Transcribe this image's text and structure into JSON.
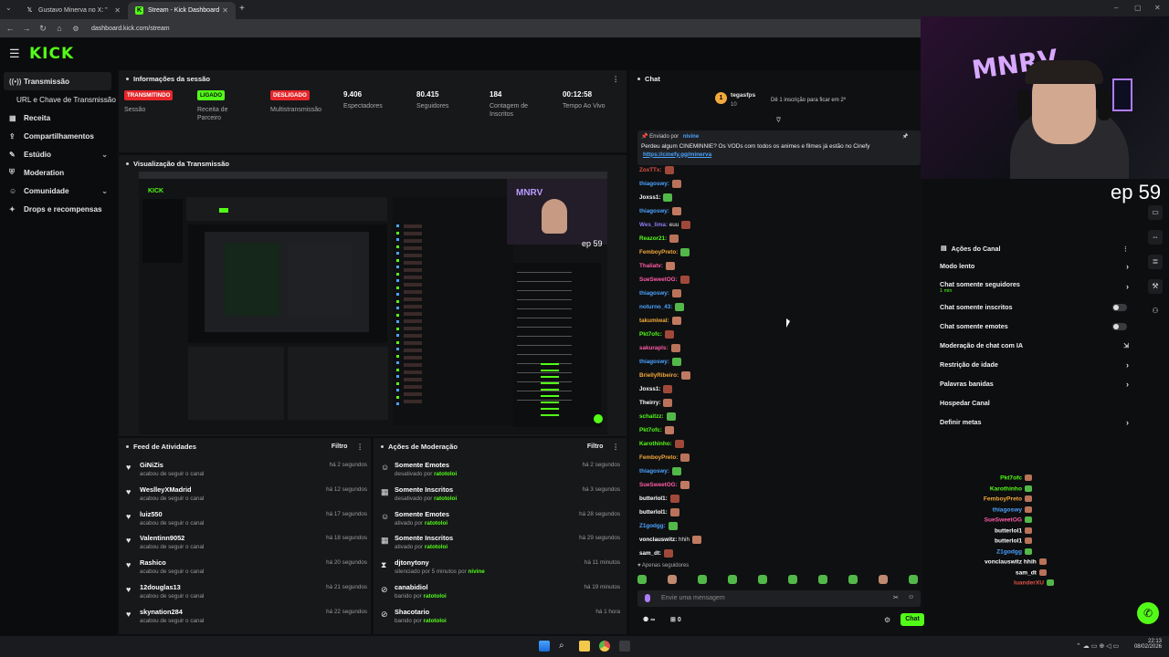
{
  "browser": {
    "tabs": [
      {
        "label": "Gustavo Minerva no X: \"",
        "active": false
      },
      {
        "label": "Stream - Kick Dashboard",
        "active": true
      }
    ],
    "new_tab": "+",
    "url": "dashboard.kick.com/stream"
  },
  "kick": {
    "logo": "KICK"
  },
  "sidebar": {
    "items": [
      {
        "label": "Transmissão",
        "icon": "broadcast-icon"
      },
      {
        "label": "URL e Chave de Transmissão",
        "icon": ""
      },
      {
        "label": "Receita",
        "icon": "revenue-icon"
      },
      {
        "label": "Compartilhamentos",
        "icon": "share-icon"
      },
      {
        "label": "Estúdio",
        "icon": "studio-icon"
      },
      {
        "label": "Moderation",
        "icon": "moderation-icon"
      },
      {
        "label": "Comunidade",
        "icon": "community-icon"
      },
      {
        "label": "Drops e recompensas",
        "icon": "drops-icon"
      }
    ]
  },
  "session": {
    "title": "Informações da sessão",
    "stats": [
      {
        "badge": "TRANSMITINDO",
        "label": "Sessão"
      },
      {
        "badge": "LIGADO",
        "label": "Receita de Parceiro"
      },
      {
        "badge": "DESLIGADO",
        "label": "Multistransmissão"
      },
      {
        "value": "9.406",
        "label": "Espectadores"
      },
      {
        "value": "80.415",
        "label": "Seguidores"
      },
      {
        "value": "184",
        "label": "Contagem de Inscritos"
      },
      {
        "value": "00:12:58",
        "label": "Tempo Ao Vivo"
      }
    ]
  },
  "preview": {
    "title": "Visualização da Transmissão",
    "overlay_text": "ep 59"
  },
  "activity": {
    "title": "Feed de Atividades",
    "filter": "Filtro",
    "rows": [
      {
        "name": "GiNiZis",
        "sub": "acabou de seguir o canal",
        "time": "há 2 segundos"
      },
      {
        "name": "WeslleyXMadrid",
        "sub": "acabou de seguir o canal",
        "time": "há 12 segundos"
      },
      {
        "name": "luiz550",
        "sub": "acabou de seguir o canal",
        "time": "há 17 segundos"
      },
      {
        "name": "Valentinn9052",
        "sub": "acabou de seguir o canal",
        "time": "há 18 segundos"
      },
      {
        "name": "Rashico",
        "sub": "acabou de seguir o canal",
        "time": "há 20 segundos"
      },
      {
        "name": "12douglas13",
        "sub": "acabou de seguir o canal",
        "time": "há 21 segundos"
      },
      {
        "name": "skynation284",
        "sub": "acabou de seguir o canal",
        "time": "há 22 segundos"
      }
    ]
  },
  "modactions": {
    "title": "Ações de Moderação",
    "filter": "Filtro",
    "rows": [
      {
        "name": "Somente Emotes",
        "pre": "desativado por",
        "mod": "ratotoloi",
        "time": "há 2 segundos"
      },
      {
        "name": "Somente Inscritos",
        "pre": "desativado por",
        "mod": "ratotoloi",
        "time": "há 3 segundos"
      },
      {
        "name": "Somente Emotes",
        "pre": "ativado por",
        "mod": "ratotoloi",
        "time": "há 28 segundos"
      },
      {
        "name": "Somente Inscritos",
        "pre": "ativado por",
        "mod": "ratotoloi",
        "time": "há 29 segundos"
      },
      {
        "name": "djtonytony",
        "pre": "silenciado por 5 minutos por",
        "mod": "nivine",
        "time": "há 11 minutos"
      },
      {
        "name": "canabidiol",
        "pre": "banido por",
        "mod": "ratotoloi",
        "time": "há 19 minutos"
      },
      {
        "name": "Shacotario",
        "pre": "banido por",
        "mod": "ratotoloi",
        "time": "há 1 hora"
      }
    ]
  },
  "chat": {
    "title": "Chat",
    "sub_user": "tegasfps",
    "sub_count": "10",
    "sub_goal": "Dê 1 inscrição para ficar em 2º",
    "pinned_by_label": "Enviado por",
    "pinned_by": "nivine",
    "pinned_text": "Perdeu algum CINEMINNIE? Os VODs com todos os animes e filmes já estão no Cinefy",
    "pinned_link": "https://cinefy.gg/minerva",
    "messages": [
      {
        "user": "ZoxTTx:",
        "color": "#e0524a",
        "text": ""
      },
      {
        "user": "thiagoswy:",
        "color": "#4aa3ff",
        "text": ""
      },
      {
        "user": "Joxss1:",
        "color": "#ffffff",
        "text": ""
      },
      {
        "user": "thiagoswy:",
        "color": "#4aa3ff",
        "text": ""
      },
      {
        "user": "Wes_lima:",
        "color": "#8b7cf6",
        "text": "euu"
      },
      {
        "user": "Reazor21:",
        "color": "#53fc18",
        "text": ""
      },
      {
        "user": "FemboyPreto:",
        "color": "#f2a93b",
        "text": ""
      },
      {
        "user": "Thaliatv:",
        "color": "#ff5ca8",
        "text": ""
      },
      {
        "user": "SueSweetOG:",
        "color": "#ff5ca8",
        "text": ""
      },
      {
        "user": "thiagoswy:",
        "color": "#4aa3ff",
        "text": ""
      },
      {
        "user": "noturno_43:",
        "color": "#4aa3ff",
        "text": ""
      },
      {
        "user": "takumiwal:",
        "color": "#f2a93b",
        "text": ""
      },
      {
        "user": "Pkt7ofc:",
        "color": "#53fc18",
        "text": ""
      },
      {
        "user": "sakurapls:",
        "color": "#ff5ca8",
        "text": ""
      },
      {
        "user": "thiagoswy:",
        "color": "#4aa3ff",
        "text": ""
      },
      {
        "user": "BriellyRibeiro:",
        "color": "#f2a93b",
        "text": ""
      },
      {
        "user": "Joxss1:",
        "color": "#ffffff",
        "text": ""
      },
      {
        "user": "Theirry:",
        "color": "#ffffff",
        "text": ""
      },
      {
        "user": "schaitzz:",
        "color": "#53fc18",
        "text": ""
      },
      {
        "user": "Pkt7ofc:",
        "color": "#53fc18",
        "text": ""
      },
      {
        "user": "Karothinho:",
        "color": "#53fc18",
        "text": ""
      },
      {
        "user": "FemboyPreto:",
        "color": "#f2a93b",
        "text": ""
      },
      {
        "user": "thiagoswy:",
        "color": "#4aa3ff",
        "text": ""
      },
      {
        "user": "SueSweetOG:",
        "color": "#ff5ca8",
        "text": ""
      },
      {
        "user": "butterlol1:",
        "color": "#ffffff",
        "text": ""
      },
      {
        "user": "butterlol1:",
        "color": "#ffffff",
        "text": ""
      },
      {
        "user": "Z1godgg:",
        "color": "#4aa3ff",
        "text": ""
      },
      {
        "user": "vonclauswitz:",
        "color": "#ffffff",
        "text": "hhih"
      },
      {
        "user": "sam_dt:",
        "color": "#ffffff",
        "text": ""
      }
    ],
    "followers_only": "Apenas seguidores",
    "input_placeholder": "Envie uma mensagem",
    "infinity": "∞",
    "count": "0",
    "send_label": "Chat"
  },
  "overlay": {
    "cam_logo": "MNRV",
    "ep": "ep 59",
    "actions_title": "Ações do Canal",
    "actions": [
      {
        "label": "Modo lento",
        "control": "arrow",
        "sub": ""
      },
      {
        "label": "Chat somente seguidores",
        "control": "arrow",
        "sub": "1 min"
      },
      {
        "label": "Chat somente inscritos",
        "control": "toggle",
        "sub": ""
      },
      {
        "label": "Chat somente emotes",
        "control": "toggle",
        "sub": ""
      },
      {
        "label": "Moderação de chat com IA",
        "control": "icon",
        "sub": ""
      },
      {
        "label": "Restrição de idade",
        "control": "arrow",
        "sub": ""
      },
      {
        "label": "Palavras banidas",
        "control": "arrow",
        "sub": ""
      },
      {
        "label": "Hospedar Canal",
        "control": "none",
        "sub": ""
      },
      {
        "label": "Definir metas",
        "control": "arrow",
        "sub": ""
      }
    ],
    "chat_names": [
      {
        "name": "Pkt7ofc",
        "color": "#53fc18"
      },
      {
        "name": "Karothinho",
        "color": "#53fc18"
      },
      {
        "name": "FemboyPreto",
        "color": "#f2a93b"
      },
      {
        "name": "thiagoswy",
        "color": "#4aa3ff"
      },
      {
        "name": "SueSweetOG",
        "color": "#ff5ca8"
      },
      {
        "name": "butterlol1",
        "color": "#ffffff"
      },
      {
        "name": "butterlol1",
        "color": "#ffffff"
      },
      {
        "name": "Z1godgg",
        "color": "#4aa3ff"
      },
      {
        "name": "vonclauswitz",
        "text": "hhih",
        "color": "#ffffff"
      },
      {
        "name": "sam_dt",
        "color": "#ffffff"
      },
      {
        "name": "luanderXU",
        "color": "#e0524a"
      }
    ]
  },
  "taskbar": {
    "time": "22:13",
    "date": "08/02/2026"
  },
  "colors": {
    "accent": "#53fc18",
    "live": "#e5262b"
  }
}
